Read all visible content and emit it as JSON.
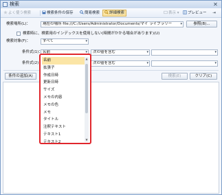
{
  "window": {
    "title": "検索",
    "close_glyph": "✕"
  },
  "toolbar": {
    "prev_results": "よく使う検索",
    "save_conditions": "検索条件の保存",
    "simple_search": "簡易検索",
    "advanced_search": "詳細検索",
    "view": "表示",
    "preview": "プレビュー",
    "pin_glyph": "⇥"
  },
  "form": {
    "search_location_label": "検索場所(L)：",
    "search_location_value": "現在の場所 file:///C:/Users/Administrator/Documents/マイ ライブラリー",
    "browse_button": "参照(B)...",
    "index_checkbox_label": "検索時に、検索用のインデックスを使用しない(時間がかかる場合があります)(U)",
    "target_label": "検索対象(F)：",
    "target_value": "すべて",
    "cond1_label": "条件式(1)：",
    "cond1_field": "名前",
    "cond1_operator": "次の値を含む",
    "cond2_label": "条件式(2)：",
    "cond2_operator": "次の値を含む",
    "add_condition_button": "条件の追加(A)",
    "search_button": "検索(E)",
    "clear_button": "クリア(C)"
  },
  "dropdown": {
    "selected": "名前",
    "items": [
      "名前",
      "拡張子",
      "作成日時",
      "更新日時",
      "サイズ",
      "メモの内容",
      "メモの色",
      "メモ",
      "タイトル",
      "注釈テキスト",
      "テキスト1",
      "テキスト2"
    ]
  },
  "colors": {
    "highlight": "#fbe5a6",
    "callout_border": "#e0262c",
    "titlebar": "#c9d9ee"
  },
  "icons": [
    "app-icon",
    "star-icon",
    "save-icon",
    "search-icon",
    "advanced-search-icon",
    "view-icon",
    "preview-icon"
  ]
}
